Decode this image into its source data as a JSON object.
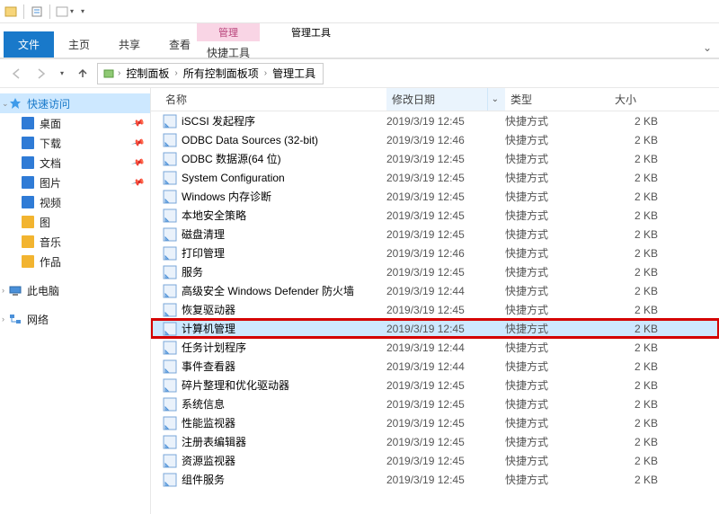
{
  "titlebar": {
    "dropdown_hint": "▾"
  },
  "ribbon": {
    "file": "文件",
    "tabs": [
      "主页",
      "共享",
      "查看"
    ],
    "context_group_1": {
      "header": "管理",
      "tab": "快捷工具"
    },
    "context_group_2": {
      "header": "管理工具",
      "tab": ""
    },
    "collapse_hint": "⌄"
  },
  "addressbar": {
    "crumbs": [
      "控制面板",
      "所有控制面板项",
      "管理工具"
    ]
  },
  "sidebar": {
    "quick_access": "快速访问",
    "items": [
      {
        "label": "桌面",
        "color": "#2f7bd6",
        "pinned": true
      },
      {
        "label": "下载",
        "color": "#2f7bd6",
        "pinned": true
      },
      {
        "label": "文档",
        "color": "#2f7bd6",
        "pinned": true
      },
      {
        "label": "图片",
        "color": "#2f7bd6",
        "pinned": true
      },
      {
        "label": "视频",
        "color": "#2f7bd6",
        "pinned": false
      },
      {
        "label": "图",
        "color": "#f2b430",
        "pinned": false
      },
      {
        "label": "音乐",
        "color": "#f2b430",
        "pinned": false
      },
      {
        "label": "作品",
        "color": "#f2b430",
        "pinned": false
      }
    ],
    "this_pc": "此电脑",
    "network": "网络"
  },
  "columns": {
    "name": "名称",
    "date": "修改日期",
    "type": "类型",
    "size": "大小"
  },
  "files": [
    {
      "name": "iSCSI 发起程序",
      "date": "2019/3/19 12:45",
      "type": "快捷方式",
      "size": "2 KB"
    },
    {
      "name": "ODBC Data Sources (32-bit)",
      "date": "2019/3/19 12:46",
      "type": "快捷方式",
      "size": "2 KB"
    },
    {
      "name": "ODBC 数据源(64 位)",
      "date": "2019/3/19 12:45",
      "type": "快捷方式",
      "size": "2 KB"
    },
    {
      "name": "System Configuration",
      "date": "2019/3/19 12:45",
      "type": "快捷方式",
      "size": "2 KB"
    },
    {
      "name": "Windows 内存诊断",
      "date": "2019/3/19 12:45",
      "type": "快捷方式",
      "size": "2 KB"
    },
    {
      "name": "本地安全策略",
      "date": "2019/3/19 12:45",
      "type": "快捷方式",
      "size": "2 KB"
    },
    {
      "name": "磁盘清理",
      "date": "2019/3/19 12:45",
      "type": "快捷方式",
      "size": "2 KB"
    },
    {
      "name": "打印管理",
      "date": "2019/3/19 12:46",
      "type": "快捷方式",
      "size": "2 KB"
    },
    {
      "name": "服务",
      "date": "2019/3/19 12:45",
      "type": "快捷方式",
      "size": "2 KB"
    },
    {
      "name": "高级安全 Windows Defender 防火墙",
      "date": "2019/3/19 12:44",
      "type": "快捷方式",
      "size": "2 KB"
    },
    {
      "name": "恢复驱动器",
      "date": "2019/3/19 12:45",
      "type": "快捷方式",
      "size": "2 KB"
    },
    {
      "name": "计算机管理",
      "date": "2019/3/19 12:45",
      "type": "快捷方式",
      "size": "2 KB",
      "selected": true,
      "highlighted": true
    },
    {
      "name": "任务计划程序",
      "date": "2019/3/19 12:44",
      "type": "快捷方式",
      "size": "2 KB"
    },
    {
      "name": "事件查看器",
      "date": "2019/3/19 12:44",
      "type": "快捷方式",
      "size": "2 KB"
    },
    {
      "name": "碎片整理和优化驱动器",
      "date": "2019/3/19 12:45",
      "type": "快捷方式",
      "size": "2 KB"
    },
    {
      "name": "系统信息",
      "date": "2019/3/19 12:45",
      "type": "快捷方式",
      "size": "2 KB"
    },
    {
      "name": "性能监视器",
      "date": "2019/3/19 12:45",
      "type": "快捷方式",
      "size": "2 KB"
    },
    {
      "name": "注册表编辑器",
      "date": "2019/3/19 12:45",
      "type": "快捷方式",
      "size": "2 KB"
    },
    {
      "name": "资源监视器",
      "date": "2019/3/19 12:45",
      "type": "快捷方式",
      "size": "2 KB"
    },
    {
      "name": "组件服务",
      "date": "2019/3/19 12:45",
      "type": "快捷方式",
      "size": "2 KB"
    }
  ]
}
